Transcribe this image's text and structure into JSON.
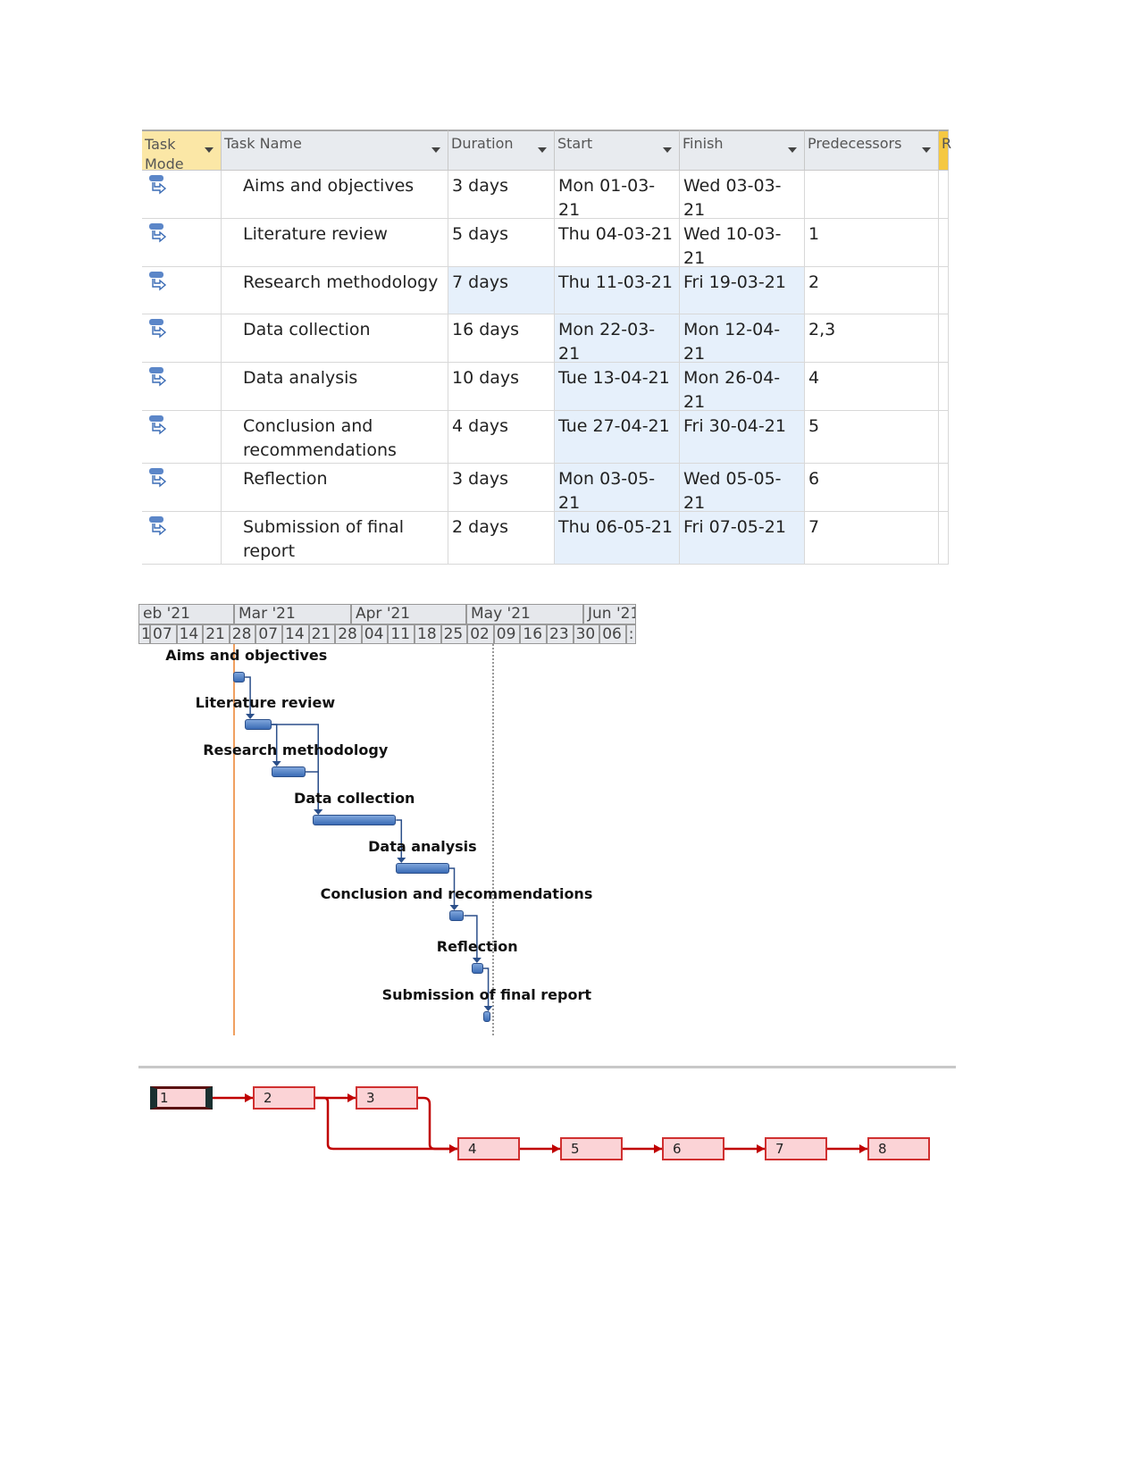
{
  "table": {
    "columns": [
      "Task Mode",
      "Task Name",
      "Duration",
      "Start",
      "Finish",
      "Predecessors",
      "R"
    ],
    "rows": [
      {
        "name": "Aims and objectives",
        "duration": "3 days",
        "start": "Mon 01-03-21",
        "finish": "Wed 03-03-21",
        "pred": ""
      },
      {
        "name": "Literature review",
        "duration": "5 days",
        "start": "Thu 04-03-21",
        "finish": "Wed 10-03-21",
        "pred": "1"
      },
      {
        "name": "Research methodology",
        "duration": "7 days",
        "start": "Thu 11-03-21",
        "finish": "Fri 19-03-21",
        "pred": "2"
      },
      {
        "name": "Data collection",
        "duration": "16 days",
        "start": "Mon 22-03-21",
        "finish": "Mon 12-04-21",
        "pred": "2,3"
      },
      {
        "name": "Data analysis",
        "duration": "10 days",
        "start": "Tue 13-04-21",
        "finish": "Mon 26-04-21",
        "pred": "4"
      },
      {
        "name": "Conclusion and recommendations",
        "duration": "4 days",
        "start": "Tue 27-04-21",
        "finish": "Fri 30-04-21",
        "pred": "5"
      },
      {
        "name": "Reflection",
        "duration": "3 days",
        "start": "Mon 03-05-21",
        "finish": "Wed 05-05-21",
        "pred": "6"
      },
      {
        "name": "Submission of final report",
        "duration": "2 days",
        "start": "Thu 06-05-21",
        "finish": "Fri 07-05-21",
        "pred": "7"
      }
    ],
    "task_mode_icon": "auto-scheduled-task-icon"
  },
  "gantt": {
    "months": [
      "eb '21",
      "Mar '21",
      "Apr '21",
      "May '21",
      "Jun '21"
    ],
    "weeks": [
      "1",
      "07",
      "14",
      "21",
      "28",
      "07",
      "14",
      "21",
      "28",
      "04",
      "11",
      "18",
      "25",
      "02",
      "09",
      "16",
      "23",
      "30",
      "06",
      ":"
    ],
    "bars": [
      {
        "label": "Aims and objectives",
        "start": "2021-03-01",
        "end": "2021-03-03"
      },
      {
        "label": "Literature review",
        "start": "2021-03-04",
        "end": "2021-03-10"
      },
      {
        "label": "Research methodology",
        "start": "2021-03-11",
        "end": "2021-03-19"
      },
      {
        "label": "Data collection",
        "start": "2021-03-22",
        "end": "2021-04-12"
      },
      {
        "label": "Data analysis",
        "start": "2021-04-13",
        "end": "2021-04-26"
      },
      {
        "label": "Conclusion and recommendations",
        "start": "2021-04-27",
        "end": "2021-04-30"
      },
      {
        "label": "Reflection",
        "start": "2021-05-03",
        "end": "2021-05-05"
      },
      {
        "label": "Submission of final report",
        "start": "2021-05-06",
        "end": "2021-05-07"
      }
    ],
    "bar_color": "#4a7cc4",
    "today_line_color": "#f0a060"
  },
  "network": {
    "nodes": [
      "1",
      "2",
      "3",
      "4",
      "5",
      "6",
      "7",
      "8"
    ],
    "links": [
      [
        "1",
        "2"
      ],
      [
        "2",
        "3"
      ],
      [
        "2",
        "4"
      ],
      [
        "3",
        "4"
      ],
      [
        "4",
        "5"
      ],
      [
        "5",
        "6"
      ],
      [
        "6",
        "7"
      ],
      [
        "7",
        "8"
      ]
    ],
    "line_color": "#c00000",
    "box_fill": "#fbd3d6"
  }
}
